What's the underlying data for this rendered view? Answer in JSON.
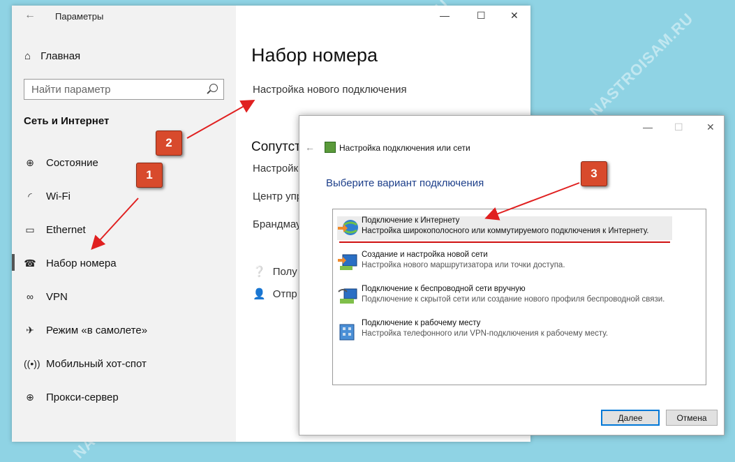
{
  "settings": {
    "title": "Параметры",
    "home": "Главная",
    "search_placeholder": "Найти параметр",
    "section": "Сеть и Интернет",
    "items": [
      {
        "label": "Состояние",
        "icon": "globe-icon"
      },
      {
        "label": "Wi-Fi",
        "icon": "wifi-icon"
      },
      {
        "label": "Ethernet",
        "icon": "ethernet-icon"
      },
      {
        "label": "Набор номера",
        "icon": "dialup-icon"
      },
      {
        "label": "VPN",
        "icon": "vpn-icon"
      },
      {
        "label": "Режим «в самолете»",
        "icon": "airplane-icon"
      },
      {
        "label": "Мобильный хот-спот",
        "icon": "hotspot-icon"
      },
      {
        "label": "Прокси-сервер",
        "icon": "proxy-icon"
      }
    ],
    "main": {
      "heading": "Набор номера",
      "new_connection_link": "Настройка нового подключения",
      "related_heading": "Сопутст",
      "related_links": [
        "Настройка",
        "Центр упр",
        "Брандмау"
      ],
      "help_links": [
        "Полу",
        "Отпр"
      ]
    }
  },
  "dialog": {
    "title": "Настройка подключения или сети",
    "heading": "Выберите вариант подключения",
    "options": [
      {
        "title": "Подключение к Интернету",
        "desc": "Настройка широкополосного или коммутируемого подключения к Интернету."
      },
      {
        "title": "Создание и настройка новой сети",
        "desc": "Настройка нового маршрутизатора или точки доступа."
      },
      {
        "title": "Подключение к беспроводной сети вручную",
        "desc": "Подключение к скрытой сети или создание нового профиля беспроводной связи."
      },
      {
        "title": "Подключение к рабочему месту",
        "desc": "Настройка телефонного или VPN-подключения к рабочему месту."
      }
    ],
    "next_button": "Далее",
    "cancel_button": "Отмена"
  },
  "annotations": {
    "badge1": "1",
    "badge2": "2",
    "badge3": "3",
    "arrow_color": "#e02020"
  },
  "watermark": "NASTROISAM.RU"
}
